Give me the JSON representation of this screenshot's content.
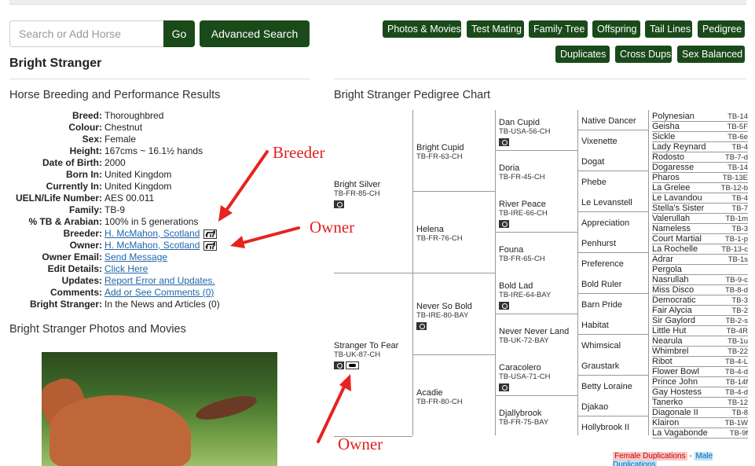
{
  "search": {
    "placeholder": "Search or Add Horse",
    "go_label": "Go",
    "advanced_label": "Advanced Search"
  },
  "nav": {
    "row1": [
      "Photos & Movies",
      "Test Mating",
      "Family Tree",
      "Offspring",
      "Tail Lines",
      "Pedigree"
    ],
    "row2": [
      "Duplicates",
      "Cross Dups",
      "Sex Balanced"
    ]
  },
  "horse_title": "Bright Stranger",
  "left_section_title": "Horse Breeding and Performance Results",
  "details": [
    {
      "label": "Breed:",
      "value": "Thoroughbred",
      "link": false
    },
    {
      "label": "Colour:",
      "value": "Chestnut",
      "link": false
    },
    {
      "label": "Sex:",
      "value": "Female",
      "link": false
    },
    {
      "label": "Height:",
      "value": "167cms ~ 16.1½ hands",
      "link": false
    },
    {
      "label": "Date of Birth:",
      "value": "2000",
      "link": false
    },
    {
      "label": "Born In:",
      "value": "United Kingdom",
      "link": false
    },
    {
      "label": "Currently In:",
      "value": "United Kingdom",
      "link": false
    },
    {
      "label": "UELN/Life Number:",
      "value": "AES 00.011",
      "link": false
    },
    {
      "label": "Family:",
      "value": "TB-9",
      "link": false
    },
    {
      "label": "% TB & Arabian:",
      "value": "100% in 5 generations",
      "link": false
    },
    {
      "label": "Breeder:",
      "value": "H. McMahon, Scotland",
      "link": true,
      "icon": "breeder-icon"
    },
    {
      "label": "Owner:",
      "value": "H. McMahon, Scotland",
      "link": true,
      "icon": "owner-icon"
    },
    {
      "label": "Owner Email:",
      "value": "Send Message",
      "link": true
    },
    {
      "label": "Edit Details:",
      "value": "Click Here",
      "link": true
    },
    {
      "label": "Updates:",
      "value": "Report Error and Updates.",
      "link": true
    },
    {
      "label": "Comments:",
      "value": "Add or See Comments (0)",
      "link": true
    },
    {
      "label": "Bright Stranger:",
      "value": "In the News and Articles (0)",
      "link": false
    }
  ],
  "photos_title": "Bright Stranger Photos and Movies",
  "pedigree_title": "Bright Stranger Pedigree Chart",
  "pedigree": {
    "subject": {
      "name": "Stranger To Fear",
      "reg": "TB-UK-87-CH"
    },
    "sire": {
      "name": "Bright Silver",
      "reg": "TB-FR-85-CH"
    },
    "dam": {
      "name": "Acadie",
      "reg": "TB-FR-80-CH"
    },
    "gen2": [
      {
        "name": "Bright Cupid",
        "reg": "TB-FR-63-CH"
      },
      {
        "name": "Helena",
        "reg": "TB-FR-76-CH"
      },
      {
        "name": "Never So Bold",
        "reg": "TB-IRE-80-BAY"
      },
      {
        "name": "Acadie",
        "reg": "TB-FR-80-CH"
      }
    ],
    "gen3": [
      {
        "name": "Dan Cupid",
        "reg": "TB-USA-56-CH",
        "cam": true
      },
      {
        "name": "Doria",
        "reg": "TB-FR-45-CH",
        "cam": false
      },
      {
        "name": "River Peace",
        "reg": "TB-IRE-66-CH",
        "cam": true
      },
      {
        "name": "Founa",
        "reg": "TB-FR-65-CH",
        "cam": false
      },
      {
        "name": "Bold Lad",
        "reg": "TB-IRE-64-BAY",
        "cam": true
      },
      {
        "name": "Never Never Land",
        "reg": "TB-UK-72-BAY",
        "cam": false
      },
      {
        "name": "Caracolero",
        "reg": "TB-USA-71-CH",
        "cam": true
      },
      {
        "name": "Djallybrook",
        "reg": "TB-FR-75-BAY",
        "cam": false
      }
    ],
    "gen4": [
      "Native Dancer",
      "Vixenette",
      "Dogat",
      "Phebe",
      "Le Levanstell",
      "Appreciation",
      "Penhurst",
      "Preference",
      "Bold Ruler",
      "Barn Pride",
      "Habitat",
      "Whimsical",
      "Graustark",
      "Betty Loraine",
      "Djakao",
      "Hollybrook II"
    ],
    "gen5": [
      {
        "name": "Polynesian",
        "reg": "TB-14"
      },
      {
        "name": "Geisha",
        "reg": "TB-5F"
      },
      {
        "name": "Sickle",
        "reg": "TB-6e"
      },
      {
        "name": "Lady Reynard",
        "reg": "TB-4"
      },
      {
        "name": "Rodosto",
        "reg": "TB-7-d"
      },
      {
        "name": "Dogaresse",
        "reg": "TB-14"
      },
      {
        "name": "Pharos",
        "reg": "TB-13E"
      },
      {
        "name": "La Grelee",
        "reg": "TB-12-b"
      },
      {
        "name": "Le Lavandou",
        "reg": "TB-4"
      },
      {
        "name": "Stella's Sister",
        "reg": "TB-7"
      },
      {
        "name": "Valerullah",
        "reg": "TB-1m"
      },
      {
        "name": "Nameless",
        "reg": "TB-3"
      },
      {
        "name": "Court Martial",
        "reg": "TB-1-p"
      },
      {
        "name": "La Rochelle",
        "reg": "TB-13-c"
      },
      {
        "name": "Adrar",
        "reg": "TB-1s"
      },
      {
        "name": "Pergola",
        "reg": ""
      },
      {
        "name": "Nasrullah",
        "reg": "TB-9-c"
      },
      {
        "name": "Miss Disco",
        "reg": "TB-8-d"
      },
      {
        "name": "Democratic",
        "reg": "TB-3"
      },
      {
        "name": "Fair Alycia",
        "reg": "TB-2"
      },
      {
        "name": "Sir Gaylord",
        "reg": "TB-2-s"
      },
      {
        "name": "Little Hut",
        "reg": "TB-4R"
      },
      {
        "name": "Nearula",
        "reg": "TB-1u"
      },
      {
        "name": "Whimbrel",
        "reg": "TB-22"
      },
      {
        "name": "Ribot",
        "reg": "TB-4-L"
      },
      {
        "name": "Flower Bowl",
        "reg": "TB-4-d"
      },
      {
        "name": "Prince John",
        "reg": "TB-14f"
      },
      {
        "name": "Gay Hostess",
        "reg": "TB-4-d"
      },
      {
        "name": "Tanerko",
        "reg": "TB-12"
      },
      {
        "name": "Diagonale II",
        "reg": "TB-8"
      },
      {
        "name": "Klairon",
        "reg": "TB-1W"
      },
      {
        "name": "La Vagabonde",
        "reg": "TB-9f"
      }
    ]
  },
  "annotations": [
    "Breeder",
    "Owner",
    "Owner"
  ],
  "legend": {
    "female": "Female Duplications",
    "sep": " - ",
    "male": "Male Duplications"
  },
  "colors": {
    "button_bg": "#1a4a1a",
    "link": "#2266aa",
    "annotation": "#e02020"
  }
}
